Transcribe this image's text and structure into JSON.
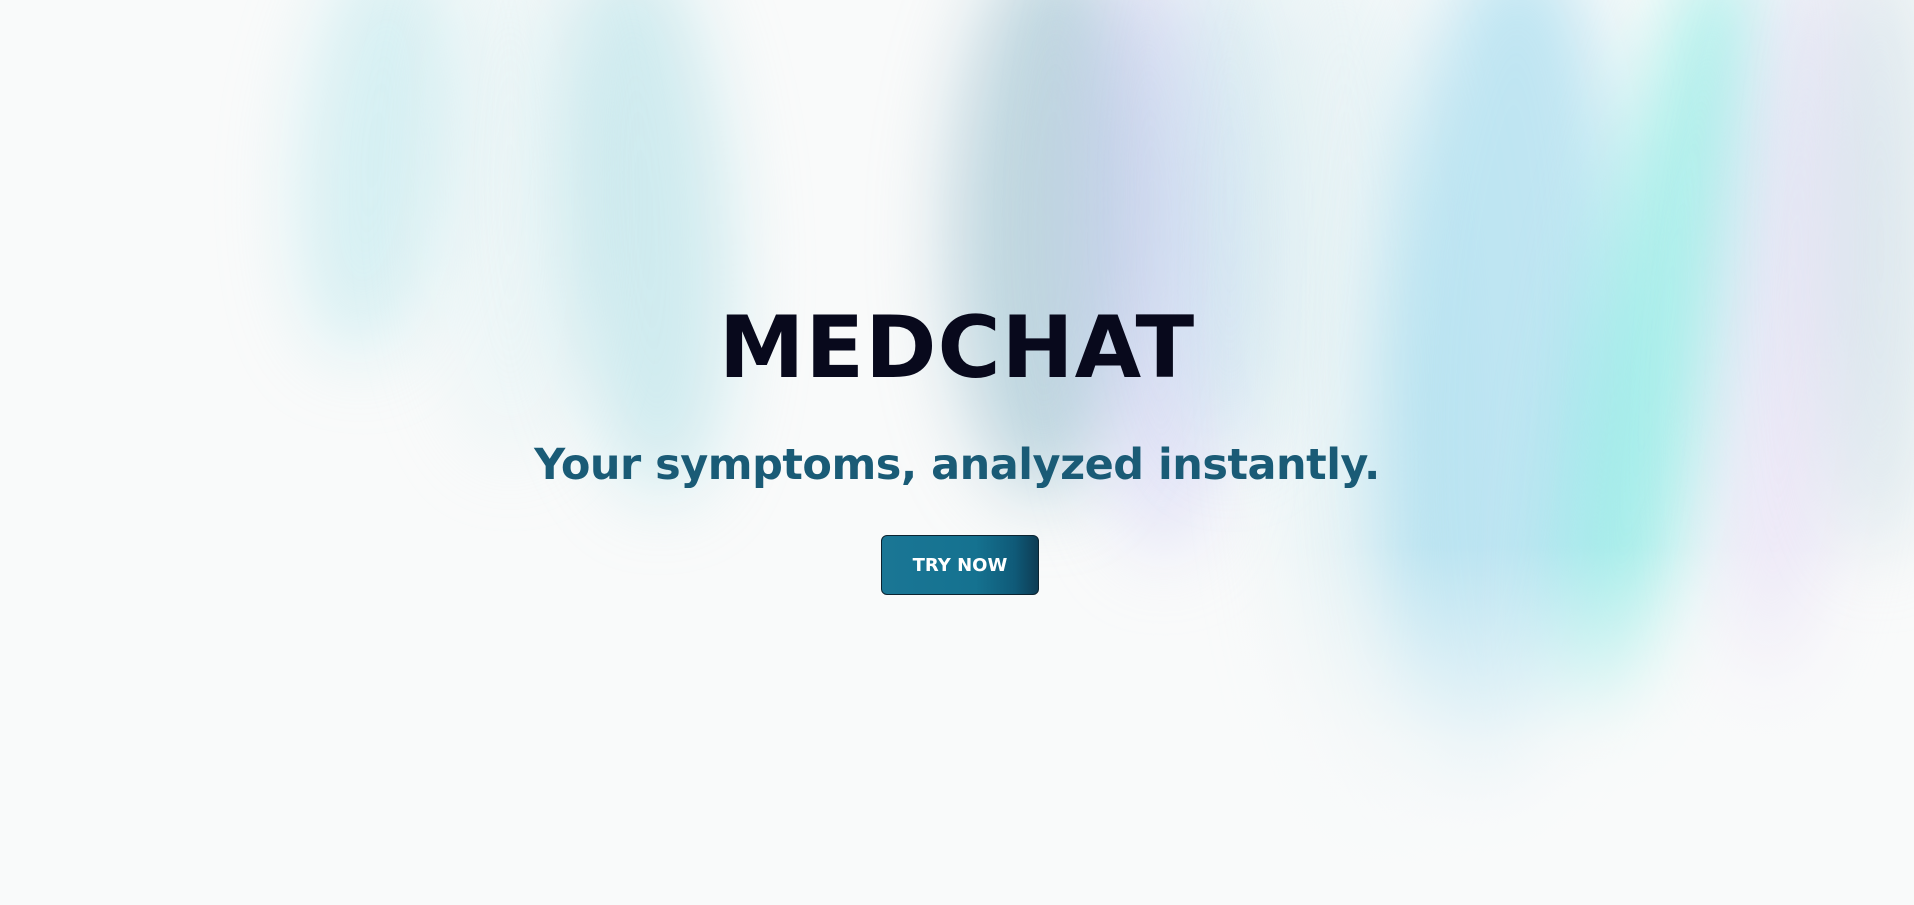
{
  "hero": {
    "title": "MEDCHAT",
    "tagline": "Your symptoms, analyzed instantly.",
    "cta_label": "TRY NOW"
  },
  "colors": {
    "title": "#08091c",
    "tagline": "#1a5b76",
    "cta_background": "#157290",
    "cta_text": "#ffffff",
    "page_background": "#f9fafa"
  }
}
